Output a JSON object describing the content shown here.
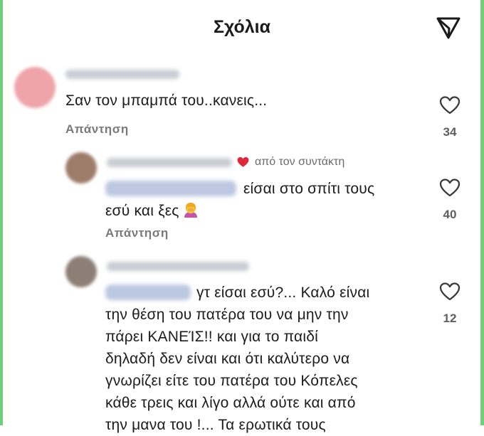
{
  "header": {
    "title": "Σχόλια"
  },
  "comments": [
    {
      "text": "Σαν τον μπαμπά του..κανεις...",
      "reply_label": "Απάντηση",
      "likes": "34"
    },
    {
      "author_tag": "από τον συντάκτη",
      "text_line1": "είσαι στο σπίτι τους",
      "text_line2": "εσύ και ξες",
      "reply_label": "Απάντηση",
      "likes": "40"
    },
    {
      "text_line1": "γτ είσαι εσύ?... Καλό είναι",
      "text_line2": "την θέση του πατέρα του να μην την",
      "text_line3": "πάρει ΚΑΝΕΊΣ!! και για το παιδί",
      "text_line4": "δηλαδή δεν είναι και ότι καλύτερο να",
      "text_line5": "γνωρίζει είτε του πατέρα του Κόπελες",
      "text_line6": "κάθε τρεις και λίγο αλλά ούτε και από",
      "text_line7": "την μανα του !... Τα ερωτικά τους",
      "likes": "12"
    }
  ],
  "icons": {
    "filter": "send-filter-icon",
    "like": "heart-outline-icon",
    "author_heart": "red-heart-icon",
    "emoji": "person-facepalm-emoji"
  },
  "colors": {
    "author_heart": "#e0263c",
    "edge": "#6fcf7a"
  }
}
